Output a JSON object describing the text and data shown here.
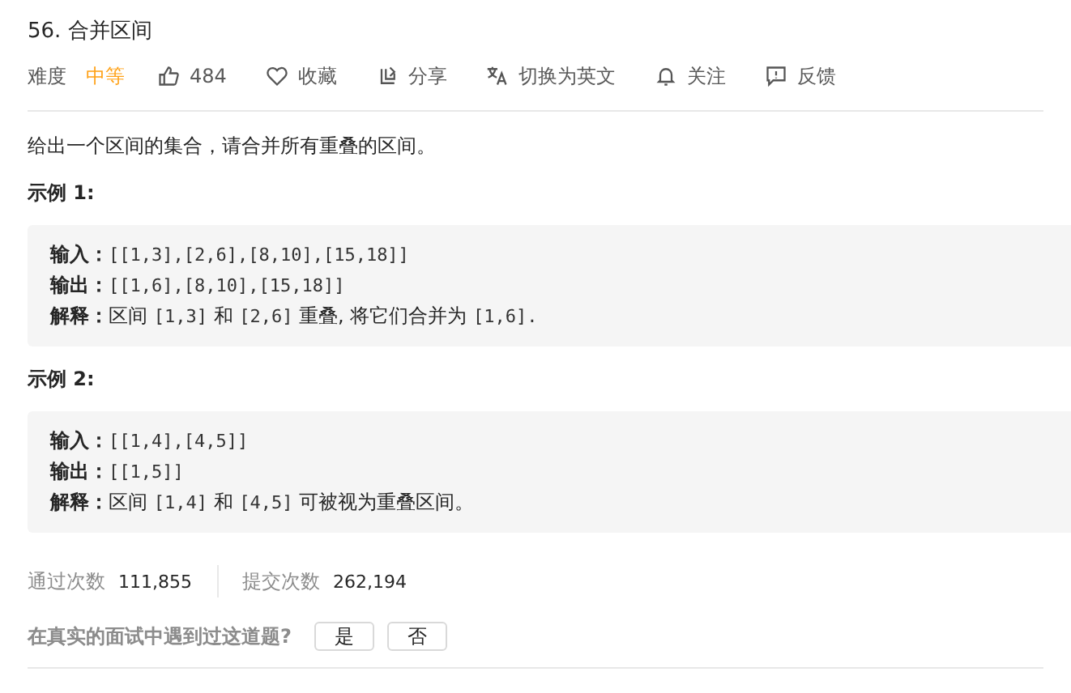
{
  "title": "56. 合并区间",
  "meta": {
    "difficulty_label": "难度",
    "difficulty": "中等",
    "actions": [
      {
        "kind": "like",
        "label": "484"
      },
      {
        "kind": "favorite",
        "label": "收藏"
      },
      {
        "kind": "share",
        "label": "分享"
      },
      {
        "kind": "translate",
        "label": "切换为英文"
      },
      {
        "kind": "follow",
        "label": "关注"
      },
      {
        "kind": "feedback",
        "label": "反馈"
      }
    ]
  },
  "description": "给出一个区间的集合，请合并所有重叠的区间。",
  "examples": [
    {
      "heading": "示例 1:",
      "lines": [
        {
          "label": "输入：",
          "parts": [
            {
              "kind": "code",
              "text": "[[1,3],[2,6],[8,10],[15,18]]"
            }
          ]
        },
        {
          "label": "输出：",
          "parts": [
            {
              "kind": "code",
              "text": "[[1,6],[8,10],[15,18]]"
            }
          ]
        },
        {
          "label": "解释：",
          "parts": [
            {
              "kind": "text",
              "text": "区间 "
            },
            {
              "kind": "code",
              "text": "[1,3]"
            },
            {
              "kind": "text",
              "text": " 和 "
            },
            {
              "kind": "code",
              "text": "[2,6]"
            },
            {
              "kind": "text",
              "text": " 重叠, 将它们合并为 "
            },
            {
              "kind": "code",
              "text": "[1,6]."
            }
          ]
        }
      ]
    },
    {
      "heading": "示例 2:",
      "lines": [
        {
          "label": "输入：",
          "parts": [
            {
              "kind": "code",
              "text": "[[1,4],[4,5]]"
            }
          ]
        },
        {
          "label": "输出：",
          "parts": [
            {
              "kind": "code",
              "text": "[[1,5]]"
            }
          ]
        },
        {
          "label": "解释：",
          "parts": [
            {
              "kind": "text",
              "text": "区间 "
            },
            {
              "kind": "code",
              "text": "[1,4]"
            },
            {
              "kind": "text",
              "text": " 和 "
            },
            {
              "kind": "code",
              "text": "[4,5]"
            },
            {
              "kind": "text",
              "text": " 可被视为重叠区间。"
            }
          ]
        }
      ]
    }
  ],
  "stats": [
    {
      "label": "通过次数",
      "value": "111,855"
    },
    {
      "label": "提交次数",
      "value": "262,194"
    }
  ],
  "survey": {
    "question": "在真实的面试中遇到过这道题?",
    "buttons": [
      "是",
      "否"
    ]
  }
}
